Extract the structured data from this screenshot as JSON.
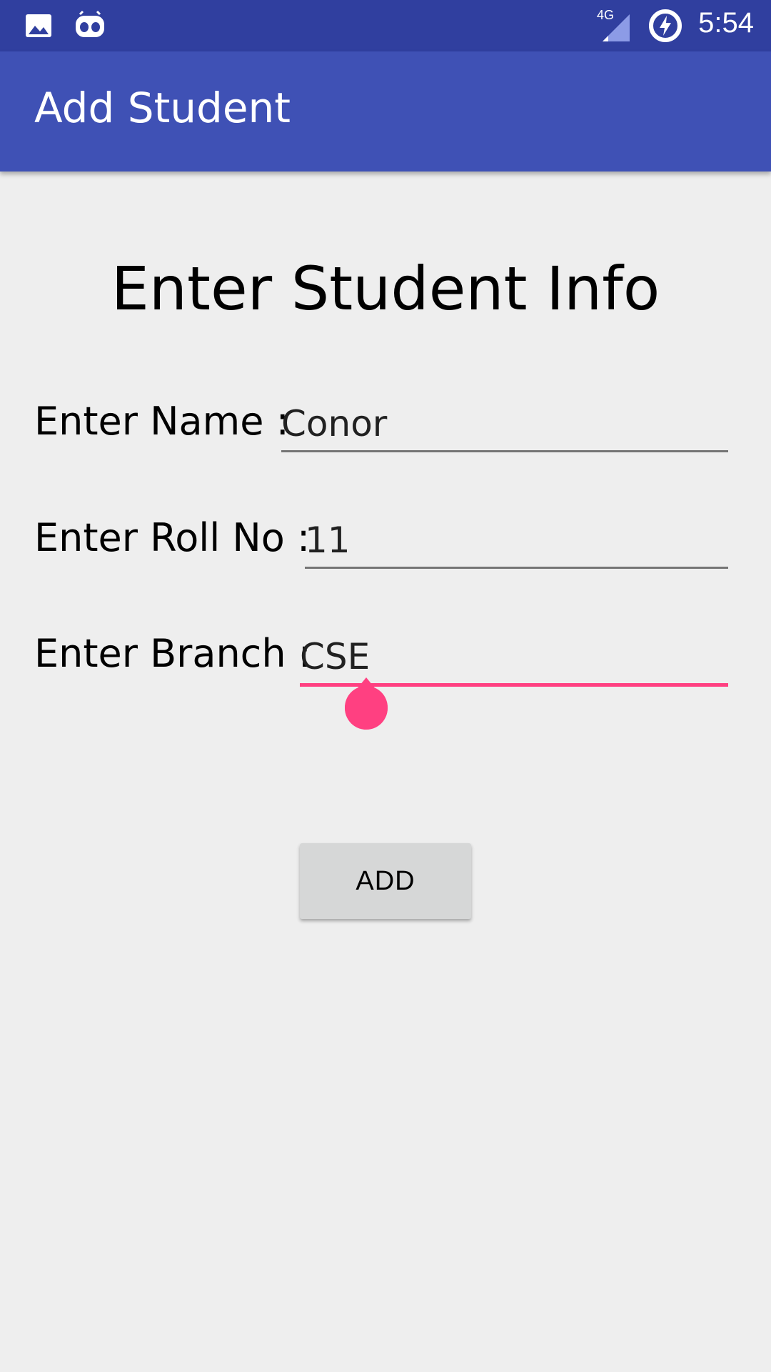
{
  "status_bar": {
    "time": "5:54",
    "network": "4G",
    "icons": [
      "image-icon",
      "android-robot-icon",
      "signal-icon",
      "battery-charging-icon"
    ]
  },
  "app_bar": {
    "title": "Add Student"
  },
  "form": {
    "heading": "Enter Student Info",
    "name": {
      "label": "Enter Name :",
      "value": "Conor"
    },
    "roll_no": {
      "label": "Enter Roll No :",
      "value": "11"
    },
    "branch": {
      "label": "Enter Branch :",
      "value": "CSE"
    },
    "add_button_label": "ADD"
  },
  "colors": {
    "status_bar": "#303f9f",
    "app_bar": "#3f51b5",
    "accent": "#ff4081",
    "background": "#eeeeee",
    "button": "#d6d7d7"
  }
}
